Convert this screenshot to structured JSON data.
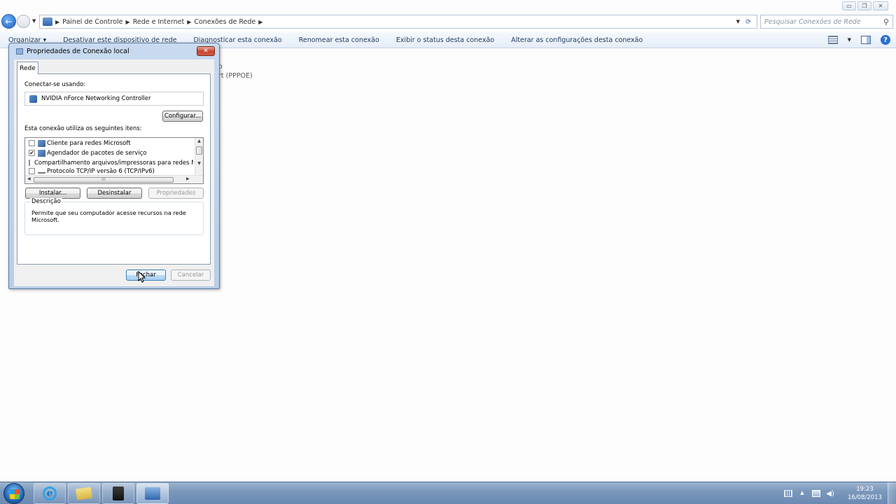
{
  "window_controls": {
    "minimize": "▭",
    "maximize": "❐",
    "close": "✕"
  },
  "address_bar": {
    "breadcrumbs": [
      "Painel de Controle",
      "Rede e Internet",
      "Conexões de Rede"
    ],
    "search_placeholder": "Pesquisar Conexões de Rede"
  },
  "command_bar": {
    "items": [
      "Organizar ▾",
      "Desativar este dispositivo de rede",
      "Diagnosticar esta conexão",
      "Renomear esta conexão",
      "Exibir o status desta conexão",
      "Alterar as configurações desta conexão"
    ]
  },
  "background": {
    "line1": "o",
    "line2": "rt (PPPOE)"
  },
  "dialog": {
    "title": "Propriedades de Conexão local",
    "tab": "Rede",
    "connect_using_label": "Conectar-se usando:",
    "adapter_name": "NVIDIA nForce Networking Controller",
    "configure_button": "Configurar...",
    "items_label": "Esta conexão utiliza os seguintes itens:",
    "items": [
      {
        "label": "Cliente para redes Microsoft",
        "checked": false,
        "check_mark": ""
      },
      {
        "label": "Agendador de pacotes de serviço",
        "checked": true,
        "check_mark": "✔"
      },
      {
        "label": "Compartilhamento arquivos/impressoras para redes Mic",
        "checked": false,
        "check_mark": ""
      },
      {
        "label": "Protocolo TCP/IP versão 6 (TCP/IPv6)",
        "checked": false,
        "check_mark": ""
      }
    ],
    "install_button": "Instalar...",
    "uninstall_button": "Desinstalar",
    "properties_button": "Propriedades",
    "description_title": "Descrição",
    "description_text": "Permite que seu computador acesse recursos na rede Microsoft.",
    "close_button": "Fechar",
    "cancel_button": "Cancelar"
  },
  "taskbar": {
    "clock_time": "19:23",
    "clock_date": "16/08/2013",
    "pinned": [
      "internet-explorer-icon",
      "folder-icon",
      "app-icon",
      "control-panel-icon"
    ]
  }
}
